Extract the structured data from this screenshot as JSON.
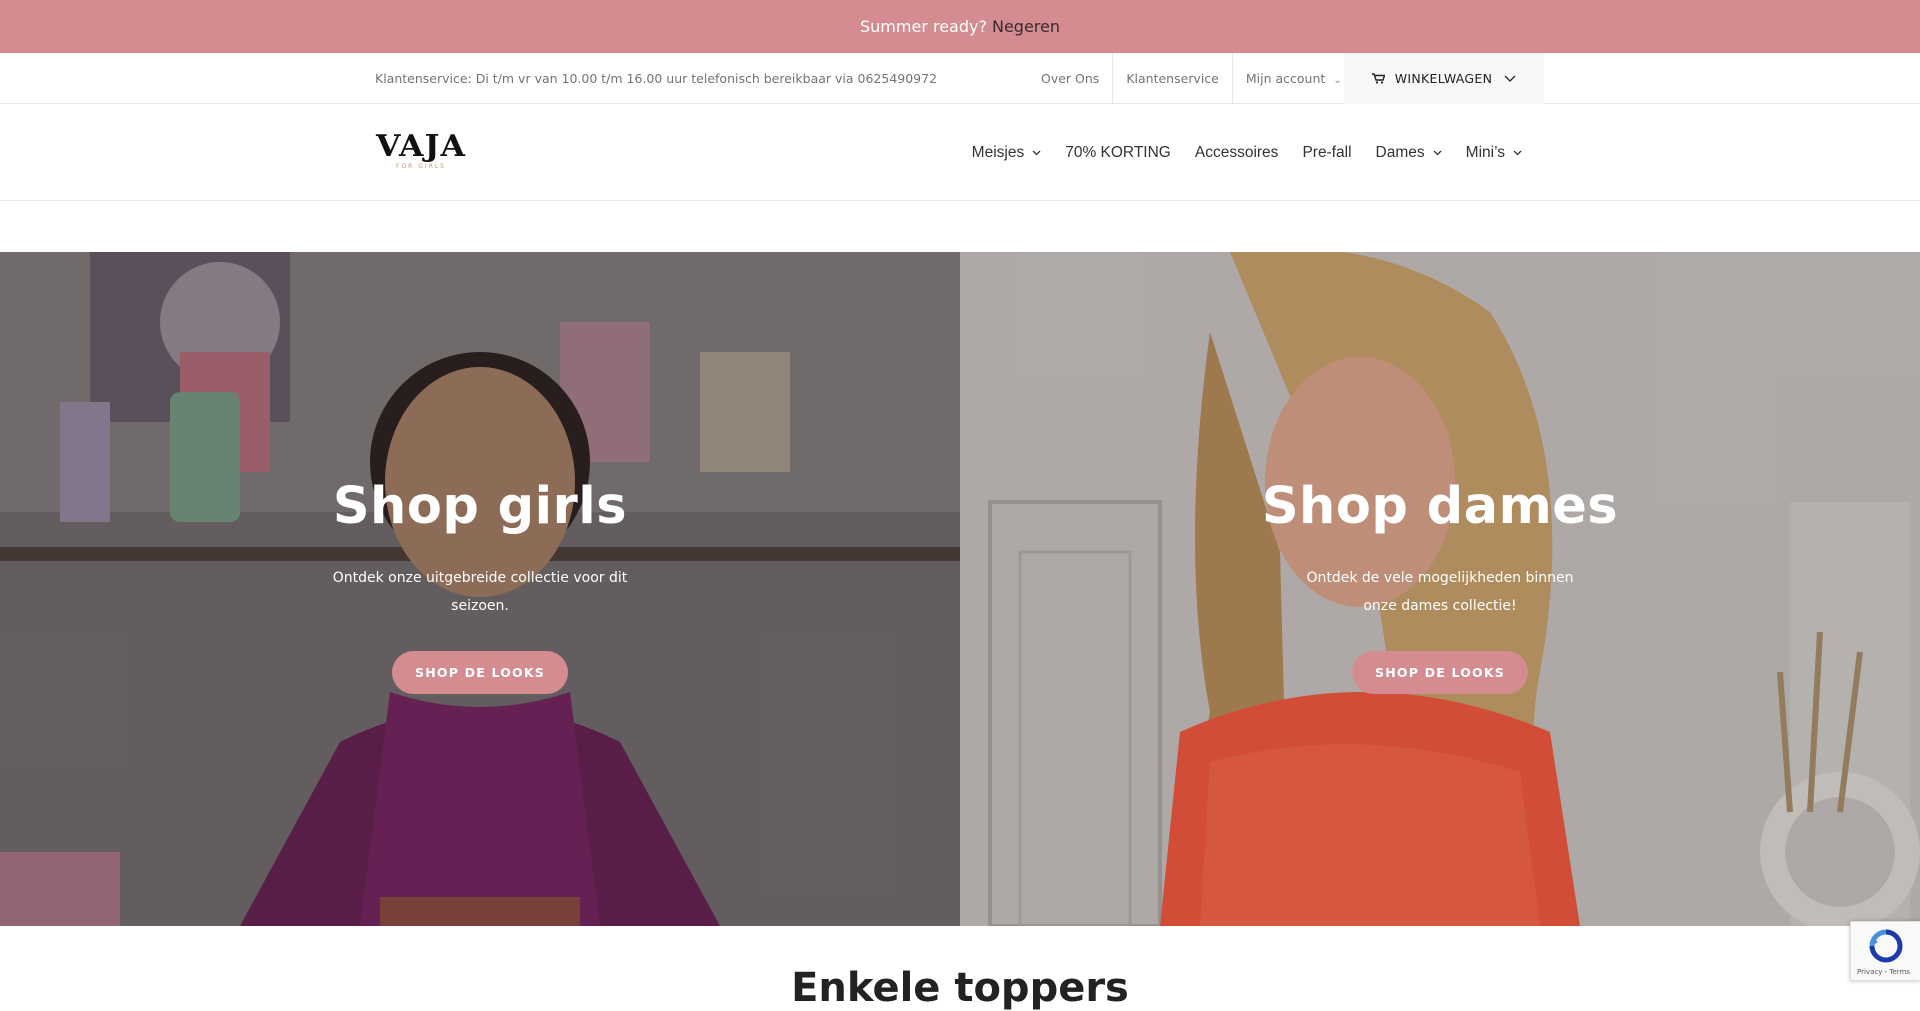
{
  "announcement": {
    "text": "Summer ready?",
    "dismiss_label": "Negeren"
  },
  "topbar": {
    "service_text": "Klantenservice: Di t/m vr van 10.00 t/m 16.00 uur telefonisch bereikbaar via 0625490972",
    "links": [
      {
        "label": "Over Ons"
      },
      {
        "label": "Klantenservice"
      },
      {
        "label": "Mijn account",
        "dropdown": true
      }
    ],
    "cart_label": "WINKELWAGEN"
  },
  "header": {
    "logo_text": "VAJA",
    "logo_subtext": "FOR GIRLS",
    "nav": [
      {
        "label": "Meisjes",
        "dropdown": true
      },
      {
        "label": "70% KORTING",
        "dropdown": false
      },
      {
        "label": "Accessoires",
        "dropdown": false
      },
      {
        "label": "Pre-fall",
        "dropdown": false
      },
      {
        "label": "Dames",
        "dropdown": true
      },
      {
        "label": "Mini’s",
        "dropdown": true
      }
    ]
  },
  "hero": {
    "left": {
      "title": "Shop girls",
      "description": "Ontdek onze uitgebreide collectie voor dit seizoen.",
      "button_label": "SHOP DE LOOKS"
    },
    "right": {
      "title": "Shop dames",
      "description": "Ontdek de vele mogelijkheden binnen onze dames collectie!",
      "button_label": "SHOP DE LOOKS"
    }
  },
  "teaser_title": "Enkele toppers",
  "recaptcha_text": "Privacy - Terms",
  "colors": {
    "accent": "#d48c90",
    "announcement_bg": "#d48c90",
    "cart_bg": "#f7f7f7"
  }
}
